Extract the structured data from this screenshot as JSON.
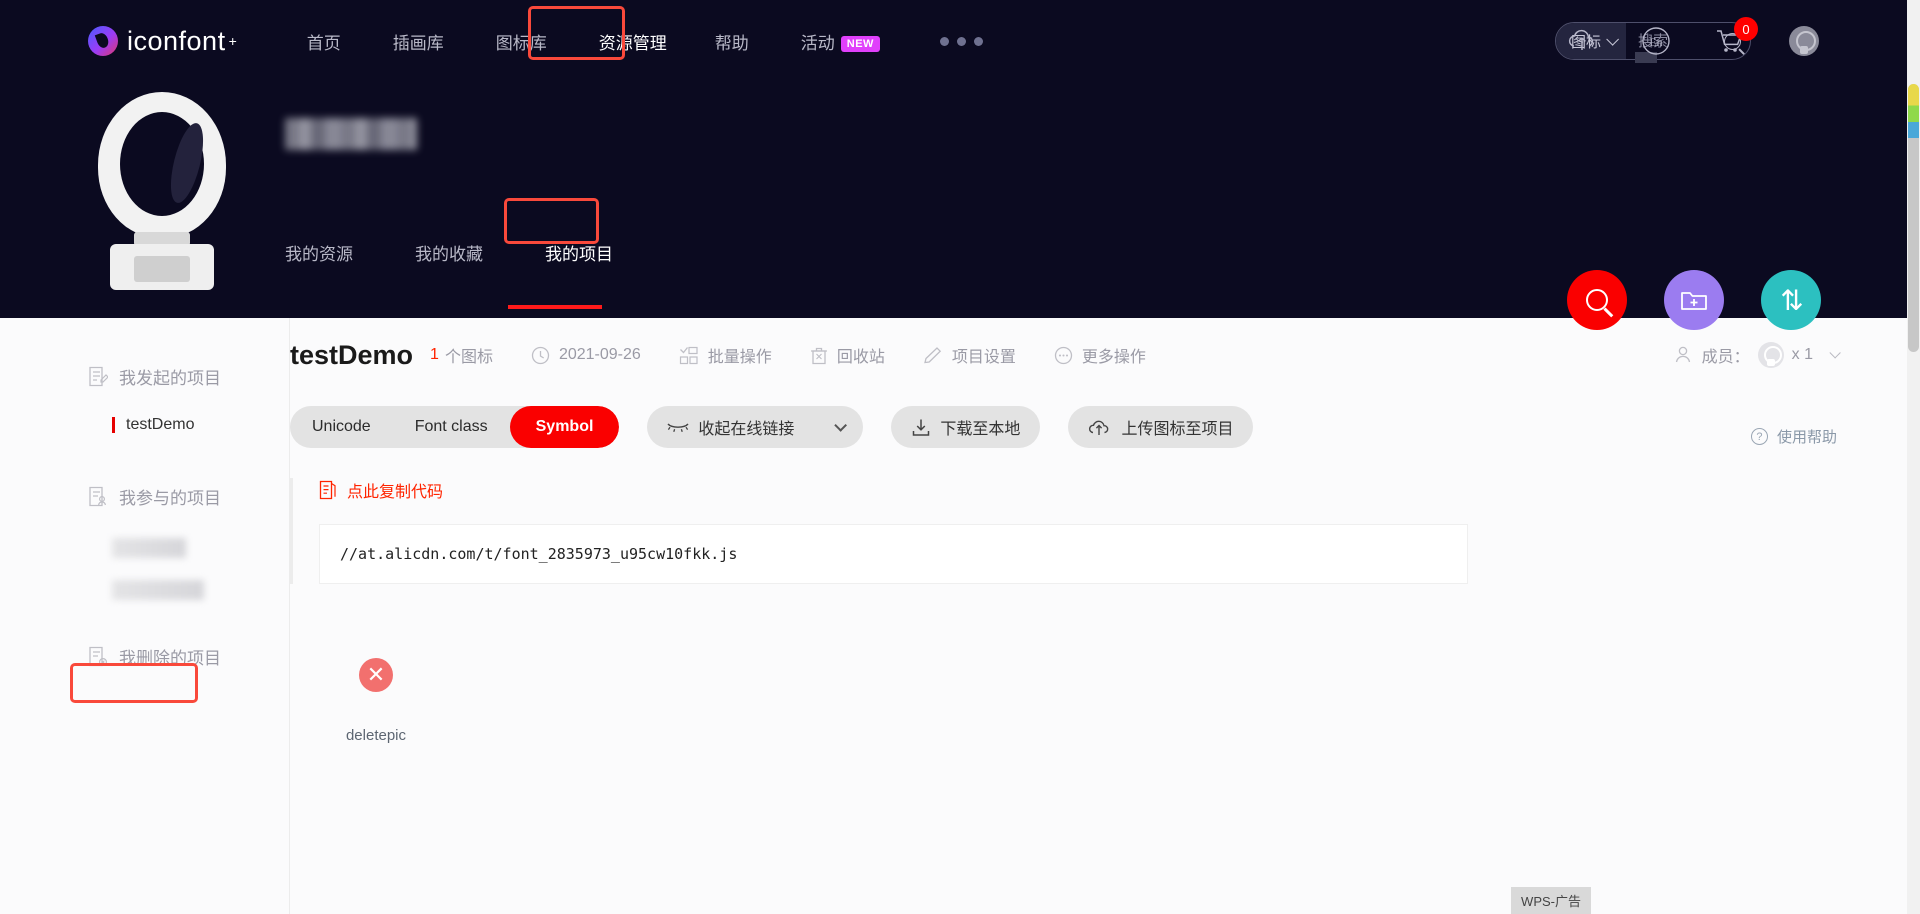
{
  "header": {
    "logo_text": "iconfont",
    "logo_plus": "+",
    "nav": [
      {
        "label": "首页",
        "highlighted": false
      },
      {
        "label": "插画库",
        "highlighted": false
      },
      {
        "label": "图标库",
        "highlighted": false
      },
      {
        "label": "资源管理",
        "highlighted": true
      },
      {
        "label": "帮助",
        "highlighted": false
      },
      {
        "label": "活动",
        "badge": "NEW",
        "highlighted": false
      }
    ],
    "more_dots": "•••",
    "search": {
      "category": "图标",
      "placeholder": "搜索",
      "value": "",
      "icon": "search-icon"
    },
    "actions": [
      {
        "name": "upload-cloud-icon"
      },
      {
        "name": "language-en-icon",
        "label": "En"
      },
      {
        "name": "cart-icon",
        "badge": "0"
      },
      {
        "name": "user-avatar-icon"
      }
    ]
  },
  "profile": {
    "username_masked": "",
    "tabs": [
      {
        "label": "我的资源",
        "active": false
      },
      {
        "label": "我的收藏",
        "active": false
      },
      {
        "label": "我的项目",
        "active": true
      }
    ]
  },
  "fabs": [
    {
      "name": "search-fab",
      "icon": "search-icon",
      "color": "#fa0000"
    },
    {
      "name": "new-project-fab",
      "icon": "folder-plus-icon",
      "color": "#9b7cf0"
    },
    {
      "name": "sort-fab",
      "icon": "sort-arrows-icon",
      "glyph": "⇅",
      "color": "#2cc0c0"
    }
  ],
  "sidebar": {
    "groups": [
      {
        "label": "我发起的项目",
        "icon": "doc-edit-icon"
      },
      {
        "label": "我参与的项目",
        "icon": "doc-user-icon"
      },
      {
        "label": "我删除的项目",
        "icon": "doc-delete-icon"
      }
    ],
    "selected_project": "testDemo"
  },
  "project": {
    "title": "testDemo",
    "icon_count": "1",
    "icon_count_unit": "个图标",
    "date": "2021-09-26",
    "date_icon": "clock-icon",
    "actions": [
      {
        "label": "批量操作",
        "icon": "batch-icon"
      },
      {
        "label": "回收站",
        "icon": "trash-icon"
      },
      {
        "label": "项目设置",
        "icon": "pencil-icon"
      },
      {
        "label": "更多操作",
        "icon": "ellipsis-circle-icon"
      }
    ],
    "members_label": "成员：",
    "members_count": "x 1"
  },
  "toolbar": {
    "segments": [
      {
        "label": "Unicode",
        "active": false
      },
      {
        "label": "Font class",
        "active": false
      },
      {
        "label": "Symbol",
        "active": true
      }
    ],
    "collapse_link": {
      "label": "收起在线链接",
      "icon": "eye-closed-icon"
    },
    "download": {
      "label": "下载至本地",
      "icon": "download-icon"
    },
    "upload": {
      "label": "上传图标至项目",
      "icon": "upload-cloud-icon"
    },
    "help": {
      "label": "使用帮助",
      "icon": "question-circle-icon"
    }
  },
  "code_panel": {
    "copy_label": "点此复制代码",
    "copy_icon": "copy-doc-icon",
    "code": "//at.alicdn.com/t/font_2835973_u95cw10fkk.js"
  },
  "icons": [
    {
      "name": "deletepic",
      "glyph": "✕",
      "color": "#f2706e"
    }
  ],
  "ad": {
    "label": "WPS-广告"
  },
  "colors": {
    "banner_bg": "#0b0a20",
    "accent_red": "#fa0000",
    "highlight_box": "#f9493b",
    "badge_purple": "#e040fb"
  }
}
